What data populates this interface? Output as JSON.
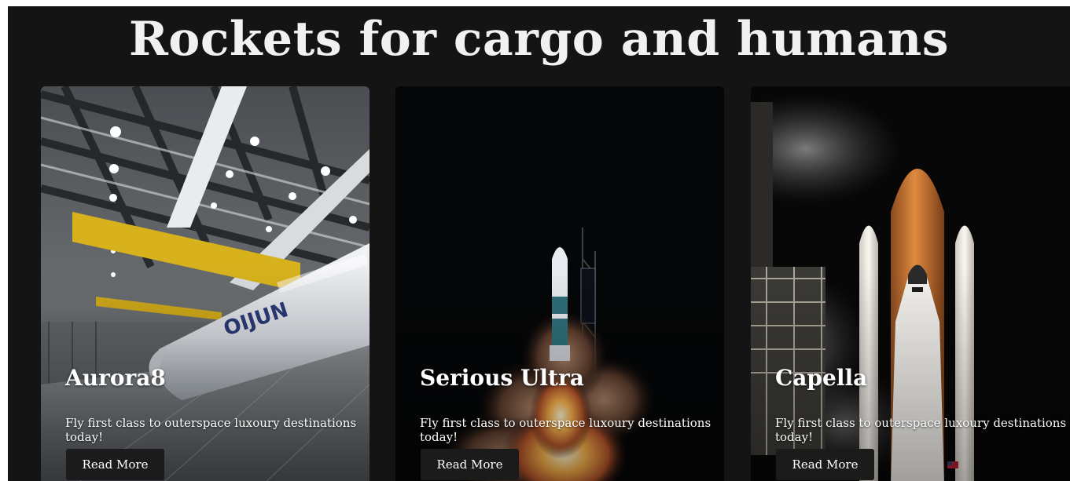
{
  "page": {
    "title": "Rockets for cargo and humans"
  },
  "cards": [
    {
      "name": "Aurora8",
      "description": "Fly first class to outerspace luxoury destinations today!",
      "button_label": "Read More"
    },
    {
      "name": "Serious Ultra",
      "description": "Fly first class to outerspace luxoury destinations today!",
      "button_label": "Read More"
    },
    {
      "name": "Capella",
      "description": "Fly first class to outerspace luxoury destinations today!",
      "button_label": "Read More"
    }
  ],
  "colors": {
    "page_background": "#141414",
    "title_text": "#f1f1f1",
    "button_background": "#1b1b1b"
  }
}
